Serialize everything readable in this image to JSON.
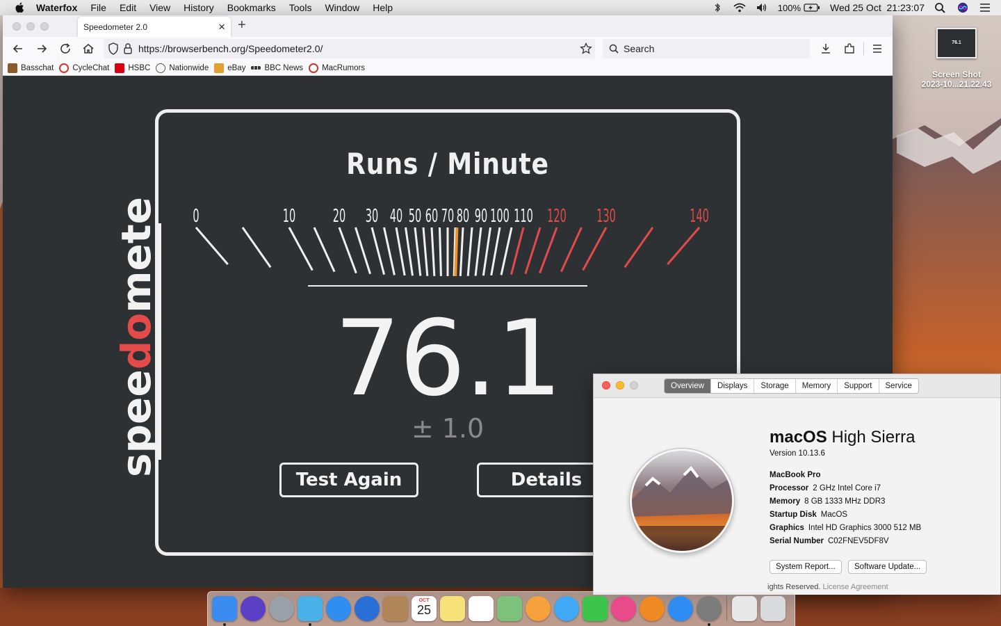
{
  "menubar": {
    "app_name": "Waterfox",
    "menus": [
      "File",
      "Edit",
      "View",
      "History",
      "Bookmarks",
      "Tools",
      "Window",
      "Help"
    ],
    "battery": "100%",
    "datetime": "Wed 25 Oct  21:23:07"
  },
  "desktop": {
    "file_name_line1": "Screen Shot",
    "file_name_line2": "2023-10...21.22.43",
    "thumb_score": "76.1"
  },
  "browser": {
    "tab_title": "Speedometer 2.0",
    "url": "https://browserbench.org/Speedometer2.0/",
    "search_placeholder": "Search",
    "bookmarks": [
      {
        "label": "Basschat",
        "color": "#8b5a2b"
      },
      {
        "label": "CycleChat",
        "color": "#d7332a"
      },
      {
        "label": "HSBC",
        "color": "#db0011"
      },
      {
        "label": "Nationwide",
        "color": "#555555"
      },
      {
        "label": "eBay",
        "color": "#e3a02c"
      },
      {
        "label": "BBC News",
        "color": "#333333"
      },
      {
        "label": "MacRumors",
        "color": "#c0392b"
      }
    ]
  },
  "speedometer": {
    "logo_pre": "spee",
    "logo_accent": "do",
    "logo_post": "meter",
    "title": "Runs / Minute",
    "score": "76.1",
    "uncertainty": "± 1.0",
    "test_again_label": "Test Again",
    "details_label": "Details",
    "ticks": [
      "0",
      "10",
      "20",
      "30",
      "40",
      "50",
      "60",
      "70",
      "80",
      "90",
      "100",
      "110",
      "120",
      "130",
      "140"
    ],
    "needle_value": 76.1,
    "accent_color": "#e24b4a",
    "needle_color": "#f0922b"
  },
  "about": {
    "tabs": [
      "Overview",
      "Displays",
      "Storage",
      "Memory",
      "Support",
      "Service"
    ],
    "active_tab": "Overview",
    "os_name_bold": "macOS",
    "os_name_rest": " High Sierra",
    "version": "Version 10.13.6",
    "model": "MacBook Pro",
    "specs": [
      {
        "label": "Processor",
        "value": "2 GHz Intel Core i7"
      },
      {
        "label": "Memory",
        "value": "8 GB 1333 MHz DDR3"
      },
      {
        "label": "Startup Disk",
        "value": "MacOS"
      },
      {
        "label": "Graphics",
        "value": "Intel HD Graphics 3000 512 MB"
      },
      {
        "label": "Serial Number",
        "value": "C02FNEV5DF8V"
      }
    ],
    "system_report_label": "System Report...",
    "software_update_label": "Software Update...",
    "footer_text": "ights Reserved.",
    "footer_link": "License Agreement"
  },
  "dock": {
    "apps": [
      {
        "name": "Finder",
        "color": "#3b8cf0",
        "running": true
      },
      {
        "name": "Siri",
        "color": "#5b3fc4",
        "running": false
      },
      {
        "name": "Launchpad",
        "color": "#9aa0a8",
        "running": false
      },
      {
        "name": "Waterfox",
        "color": "#4ab0e8",
        "running": true
      },
      {
        "name": "Safari",
        "color": "#2f8ef0",
        "running": false
      },
      {
        "name": "Thunderbird",
        "color": "#2a6fd6",
        "running": false
      },
      {
        "name": "Contacts",
        "color": "#b08658",
        "running": false
      },
      {
        "name": "Calendar",
        "color": "#ffffff",
        "running": false
      },
      {
        "name": "Notes",
        "color": "#f7e27a",
        "running": false
      },
      {
        "name": "Reminders",
        "color": "#ffffff",
        "running": false
      },
      {
        "name": "Maps",
        "color": "#7cc27a",
        "running": false
      },
      {
        "name": "Photos",
        "color": "#f6a13b",
        "running": false
      },
      {
        "name": "Messages",
        "color": "#3fa9f5",
        "running": false
      },
      {
        "name": "FaceTime",
        "color": "#3dc44a",
        "running": false
      },
      {
        "name": "iTunes",
        "color": "#e84a8a",
        "running": false
      },
      {
        "name": "iBooks",
        "color": "#f08a24",
        "running": false
      },
      {
        "name": "App Store",
        "color": "#2f8cf2",
        "running": false
      },
      {
        "name": "System Preferences",
        "color": "#7c7c7c",
        "running": true
      },
      {
        "name": "Documents",
        "color": "#e8e8e8",
        "running": false
      },
      {
        "name": "Trash",
        "color": "#d8dadc",
        "running": false
      }
    ],
    "calendar_month": "OCT",
    "calendar_day": "25"
  }
}
